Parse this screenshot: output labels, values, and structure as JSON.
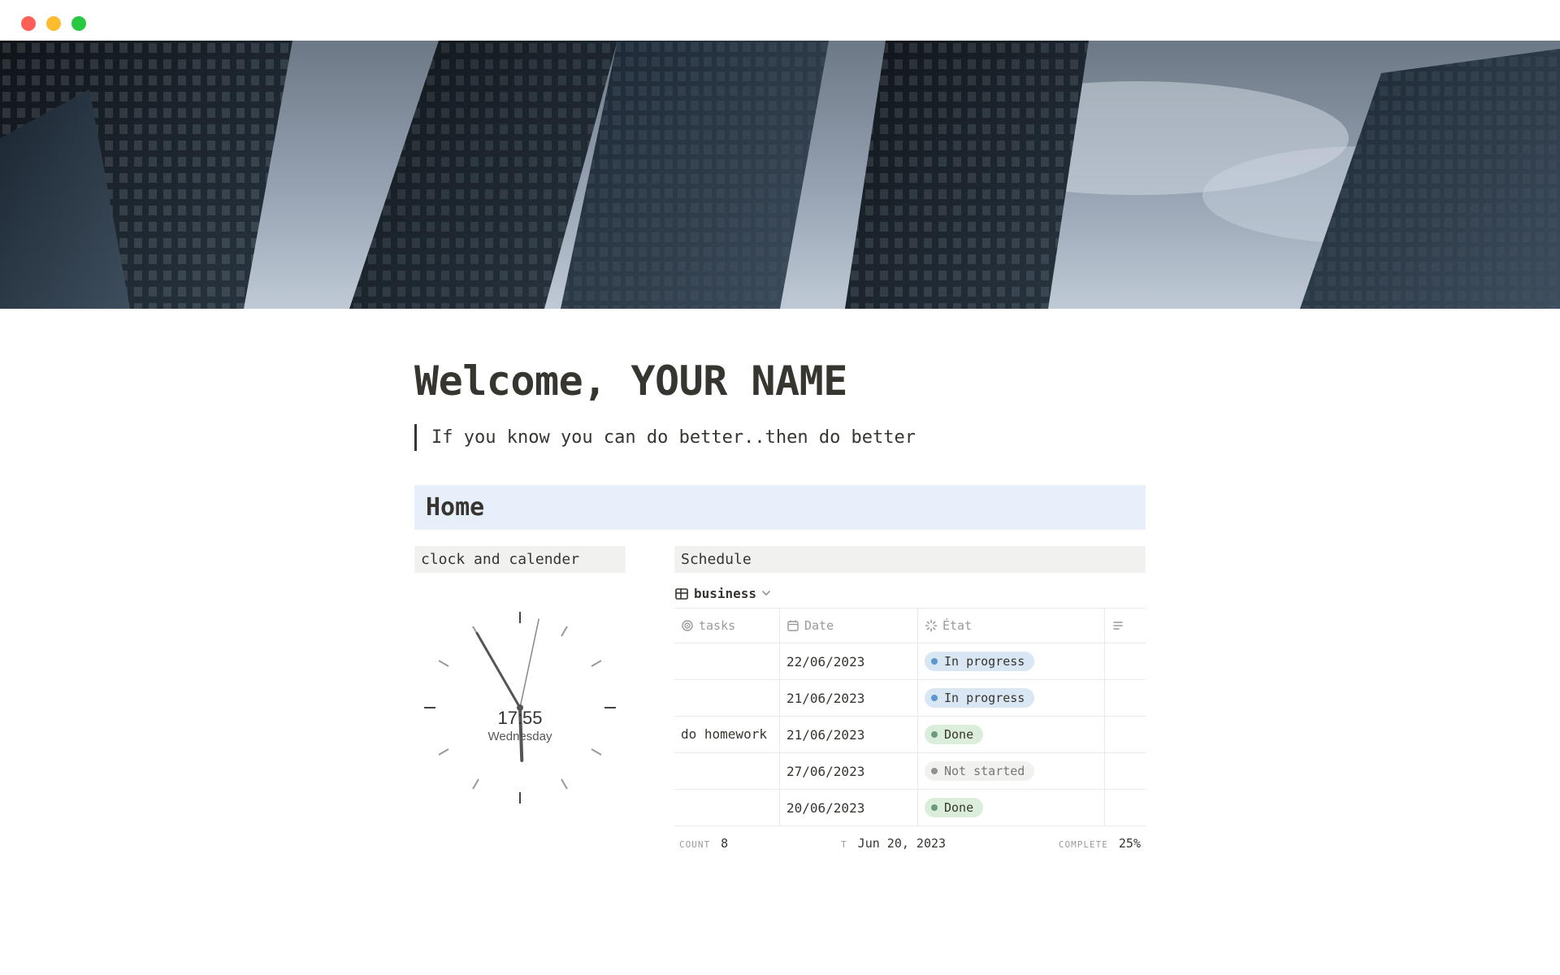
{
  "window": {
    "traffic_lights": [
      "red",
      "yellow",
      "green"
    ]
  },
  "page": {
    "title": "Welcome, YOUR NAME",
    "quote": "If you know you can do better..then do better"
  },
  "home": {
    "heading": "Home",
    "left_label": "clock and calender",
    "right_label": "Schedule",
    "clock": {
      "time": "17:55",
      "day": "Wednesday"
    },
    "view": {
      "name": "business"
    },
    "table": {
      "headers": {
        "tasks": "tasks",
        "date": "Date",
        "etat": "État"
      },
      "rows": [
        {
          "task": "",
          "date": "22/06/2023",
          "status": "In progress",
          "status_kind": "progress"
        },
        {
          "task": "",
          "date": "21/06/2023",
          "status": "In progress",
          "status_kind": "progress"
        },
        {
          "task": "do homework",
          "date": "21/06/2023",
          "status": "Done",
          "status_kind": "done"
        },
        {
          "task": "",
          "date": "27/06/2023",
          "status": "Not started",
          "status_kind": "notstarted"
        },
        {
          "task": "",
          "date": "20/06/2023",
          "status": "Done",
          "status_kind": "done"
        }
      ]
    },
    "footer": {
      "count_label": "COUNT",
      "count_value": "8",
      "date_prefix": "T",
      "date_value": "Jun 20, 2023",
      "complete_label": "COMPLETE",
      "complete_value": "25%"
    }
  }
}
